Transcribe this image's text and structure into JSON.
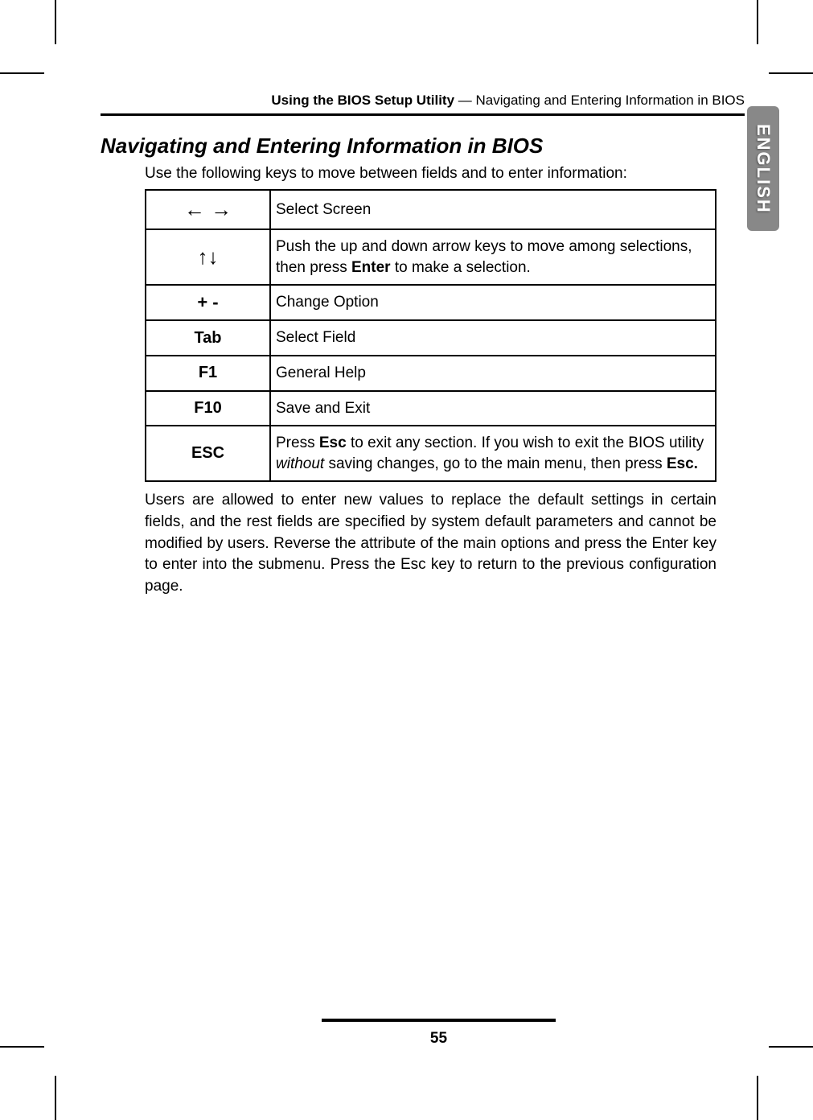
{
  "header": {
    "bold": "Using the BIOS Setup Utility",
    "rest": " — Navigating and Entering Information in BIOS"
  },
  "sideTab": "ENGLISH",
  "section": {
    "title": "Navigating and Entering Information in BIOS",
    "intro": "Use the following keys to move between fields and to enter information:"
  },
  "rows": [
    {
      "key": "← →",
      "keyClass": "arrow-lr",
      "desc": "Select Screen"
    },
    {
      "key": "↑↓",
      "keyClass": "arrow-ud",
      "descHtml": "Push the up and down arrow keys to move among selections, then press <b>Enter</b> to make a selection."
    },
    {
      "key": "+  -",
      "keyClass": "plus-minus",
      "desc": "Change Option"
    },
    {
      "key": "Tab",
      "desc": "Select Field"
    },
    {
      "key": "F1",
      "desc": "General Help"
    },
    {
      "key": "F10",
      "desc": "Save and Exit"
    },
    {
      "key": "ESC",
      "descHtml": "Press <b>Esc</b> to exit any section. If you wish to exit the BIOS utility <i>without</i> saving changes, go to the main menu, then press <b>Esc.</b>"
    }
  ],
  "bodyText": "Users are allowed to enter new values to replace the default settings in certain fields, and the rest fields are specified by system default parameters and cannot be modified by users. Reverse the attribute of the main options and press the Enter key to enter into the submenu. Press the Esc key to return to the previous configuration page.",
  "pageNumber": "55"
}
